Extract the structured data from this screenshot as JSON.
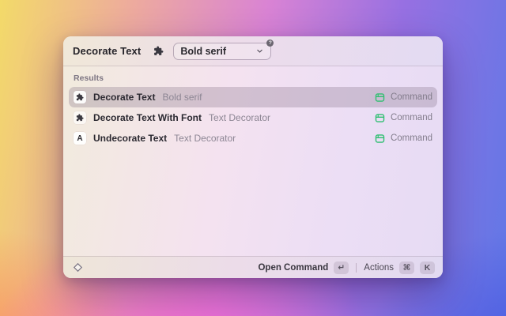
{
  "window": {
    "header": {
      "title": "Decorate Text",
      "extension_icon": "puzzle-icon",
      "dropdown": {
        "value": "Bold serif",
        "chevron_icon": "chevron-down-icon",
        "badge": "?"
      }
    },
    "results": {
      "label": "Results",
      "items": [
        {
          "icon": "puzzle-icon",
          "title": "Decorate Text",
          "subtitle": "Bold serif",
          "accessory_icon": "command-window-icon",
          "accessory": "Command",
          "selected": true
        },
        {
          "icon": "puzzle-icon",
          "title": "Decorate Text With Font",
          "subtitle": "Text Decorator",
          "accessory_icon": "command-window-icon",
          "accessory": "Command",
          "selected": false
        },
        {
          "icon": "letter-a-icon",
          "icon_letter": "A",
          "title": "Undecorate Text",
          "subtitle": "Text Decorator",
          "accessory_icon": "command-window-icon",
          "accessory": "Command",
          "selected": false
        }
      ]
    },
    "footer": {
      "logo_icon": "raycast-diamond-icon",
      "primary_action": "Open Command",
      "primary_key": "↵",
      "secondary_action": "Actions",
      "secondary_key_1": "⌘",
      "secondary_key_2": "K"
    },
    "colors": {
      "accent_green": "#2fbf71",
      "selection": "rgba(118,100,122,0.27)",
      "icon_dark": "#3a3840"
    }
  }
}
